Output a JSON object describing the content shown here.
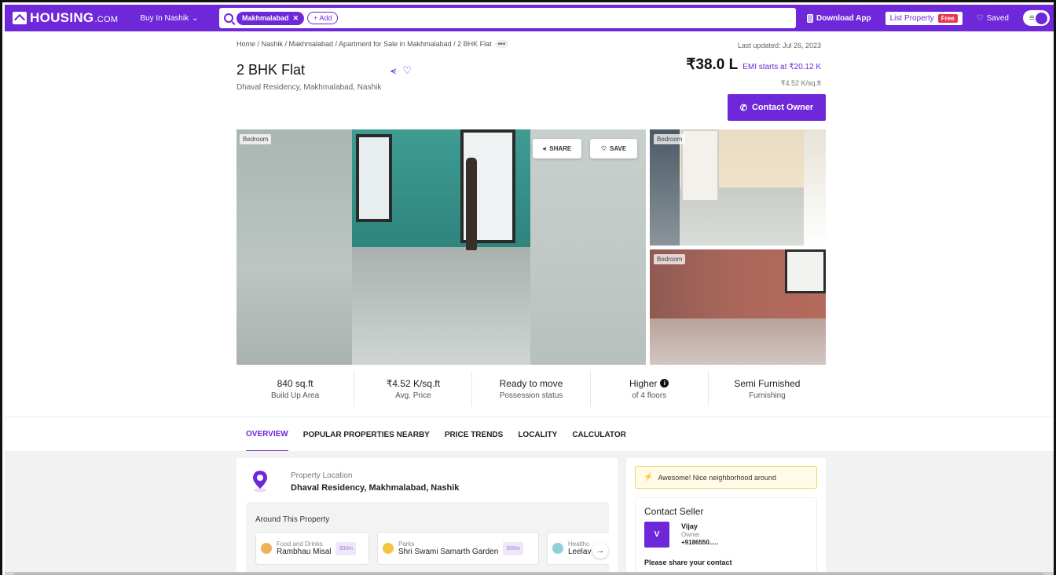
{
  "topbar": {
    "logo_text": "HOUSING",
    "logo_suffix": ".COM",
    "buy_in": "Buy In Nashik",
    "search_chip": "Makhmalabad",
    "add_chip": "+ Add",
    "download_app": "Download App",
    "list_property": "List Property",
    "free_badge": "Free",
    "saved": "Saved",
    "menu_icon": "≡"
  },
  "breadcrumb": "Home / Nashik / Makhmalabad / Apartment for Sale in Makhmalabad / 2 BHK Flat",
  "breadcrumb_more": "•••",
  "last_updated": "Last updated: Jul 26, 2023",
  "listing": {
    "title": "2 BHK Flat",
    "subtitle": "Dhaval Residency, Makhmalabad, Nashik",
    "price": "₹38.0 L",
    "emi": "EMI starts at ₹20.12 K",
    "per_sqft": "₹4.52 K/sq.ft",
    "contact_owner": "Contact Owner"
  },
  "gallery": {
    "label_main": "Bedroom",
    "label_top_right": "Bedroom",
    "label_bottom_right": "Bedroom",
    "share": "SHARE",
    "save": "SAVE"
  },
  "stats": [
    {
      "value": "840 sq.ft",
      "label": "Build Up Area"
    },
    {
      "value": "₹4.52 K/sq.ft",
      "label": "Avg. Price"
    },
    {
      "value": "Ready to move",
      "label": "Possession status"
    },
    {
      "value": "Higher",
      "label": "of 4 floors"
    },
    {
      "value": "Semi Furnished",
      "label": "Furnishing"
    }
  ],
  "tabs": [
    "OVERVIEW",
    "POPULAR PROPERTIES NEARBY",
    "PRICE TRENDS",
    "LOCALITY",
    "CALCULATOR"
  ],
  "location": {
    "label": "Property Location",
    "value": "Dhaval Residency, Makhmalabad, Nashik",
    "around_title": "Around This Property",
    "pois": [
      {
        "category": "Food and Drinks",
        "name": "Rambhau Misal",
        "distance": "300m"
      },
      {
        "category": "Parks",
        "name": "Shri Swami Samarth Garden",
        "distance": "300m"
      },
      {
        "category": "Healthc",
        "name": "Leelav"
      }
    ]
  },
  "side": {
    "neighborhood": "Awesome! Nice neighborhood around",
    "contact_title": "Contact Seller",
    "avatar_letter": "V",
    "name": "Vijay",
    "role": "Owner",
    "phone": "+9186550.....",
    "share_prompt": "Please share your contact"
  },
  "colors": {
    "brand": "#6e28d9",
    "free_badge": "#e8364d"
  }
}
